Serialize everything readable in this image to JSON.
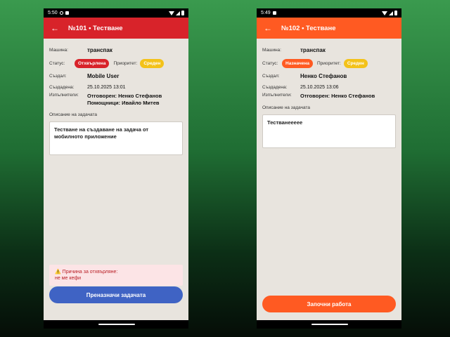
{
  "phones": [
    {
      "status_bar": {
        "time": "5:50"
      },
      "header": {
        "title": "№101 • Тестване",
        "color": "#d8232a"
      },
      "labels": {
        "machine": "Машина:",
        "status": "Статус:",
        "priority": "Приоритет:",
        "created_by": "Създал:",
        "created_at": "Създадена:",
        "assignees": "Изпълнители:",
        "description": "Описание на задачата"
      },
      "machine": "транспак",
      "status": {
        "text": "Отхвърлена",
        "color": "#d8232a"
      },
      "priority": {
        "text": "Среден",
        "color": "#f3c21a"
      },
      "created_by": "Mobile User",
      "created_at": "25.10.2025 13:01",
      "assignees": {
        "responsible": "Отговорен: Ненко Стефанов",
        "helpers": "Помощници: Ивайло Митев"
      },
      "description": "Тестване на създаване на задача от мобилното приложение",
      "rejection": {
        "title": "⚠️ Причина за отхвърляне:",
        "reason": "не ме кефи"
      },
      "action_button": {
        "label": "Преназначи задачата",
        "color": "#3f63c4"
      }
    },
    {
      "status_bar": {
        "time": "5:49"
      },
      "header": {
        "title": "№102 • Тестване",
        "color": "#ff5a22"
      },
      "labels": {
        "machine": "Машина:",
        "status": "Статус:",
        "priority": "Приоритет:",
        "created_by": "Създал:",
        "created_at": "Създадена:",
        "assignees": "Изпълнители:",
        "description": "Описание на задачата"
      },
      "machine": "транспак",
      "status": {
        "text": "Назначена",
        "color": "#ff5a22"
      },
      "priority": {
        "text": "Среден",
        "color": "#f3c21a"
      },
      "created_by": "Ненко Стефанов",
      "created_at": "25.10.2025 13:06",
      "assignees": {
        "responsible": "Отговорен: Ненко Стефанов"
      },
      "description": "Тестванееееe",
      "action_button": {
        "label": "Започни работа",
        "color": "#ff5a22"
      }
    }
  ]
}
